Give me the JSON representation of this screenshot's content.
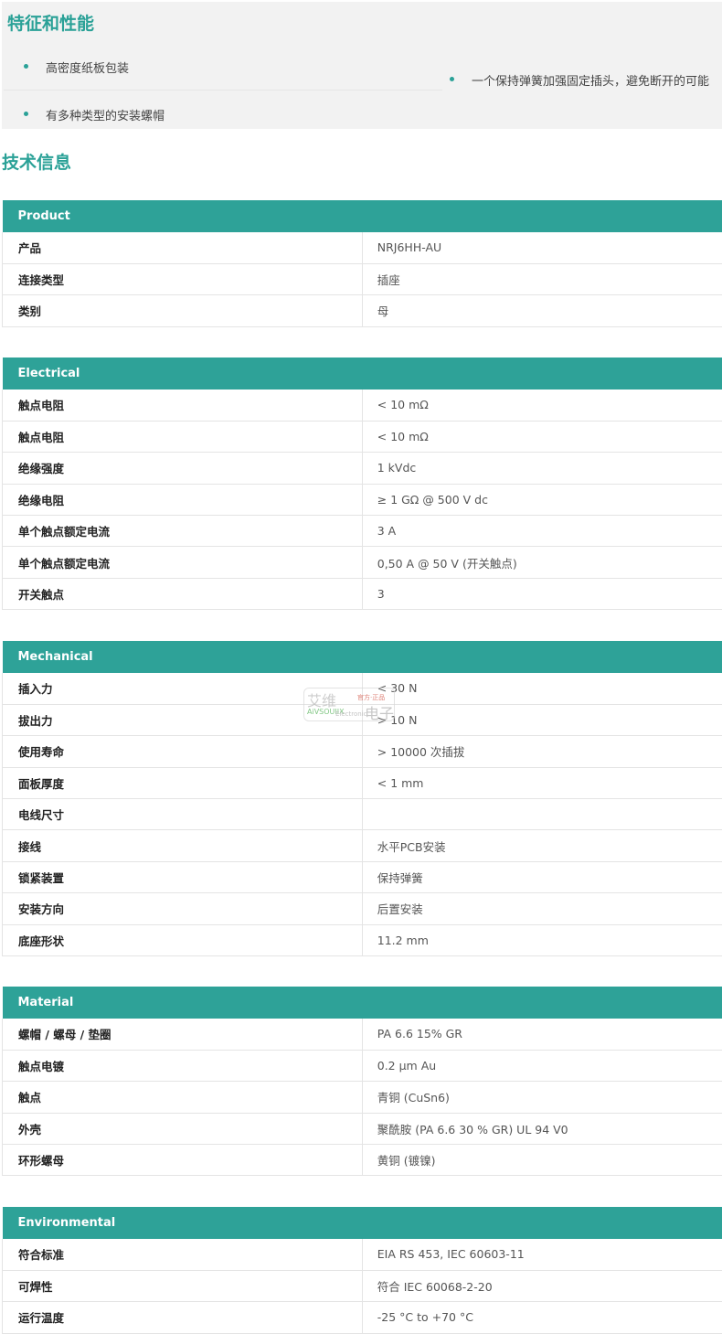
{
  "features": {
    "title": "特征和性能",
    "items": [
      "高密度纸板包装",
      "一个保持弹簧加强固定插头，避免断开的可能",
      "有多种类型的安装螺帽"
    ]
  },
  "tech": {
    "title": "技术信息"
  },
  "watermark": {
    "line1": "艾维",
    "brand": "AiVSOUIIX",
    "electronic": "Electronic",
    "tag": "官方·正品",
    "line2": "电子"
  },
  "sections": {
    "product": {
      "header": "Product",
      "rows": [
        {
          "k": "产品",
          "v": "NRJ6HH-AU"
        },
        {
          "k": "连接类型",
          "v": "插座"
        },
        {
          "k": "类别",
          "v": "母"
        }
      ]
    },
    "electrical": {
      "header": "Electrical",
      "rows": [
        {
          "k": "触点电阻",
          "v": "< 10 mΩ"
        },
        {
          "k": "触点电阻",
          "v": "< 10 mΩ"
        },
        {
          "k": "绝缘强度",
          "v": "1 kVdc"
        },
        {
          "k": "绝缘电阻",
          "v": "≥ 1 GΩ @ 500 V dc"
        },
        {
          "k": "单个触点额定电流",
          "v": "3 A"
        },
        {
          "k": "单个触点额定电流",
          "v": "0,50 A @ 50 V (开关触点)"
        },
        {
          "k": "开关触点",
          "v": "3"
        }
      ]
    },
    "mechanical": {
      "header": "Mechanical",
      "rows": [
        {
          "k": "插入力",
          "v": "< 30 N"
        },
        {
          "k": "拔出力",
          "v": "> 10 N"
        },
        {
          "k": "使用寿命",
          "v": "> 10000 次插拔"
        },
        {
          "k": "面板厚度",
          "v": "< 1 mm"
        },
        {
          "k": "电线尺寸",
          "v": ""
        },
        {
          "k": "接线",
          "v": "水平PCB安装"
        },
        {
          "k": "锁紧装置",
          "v": "保持弹簧"
        },
        {
          "k": "安装方向",
          "v": "后置安装"
        },
        {
          "k": "底座形状",
          "v": "11.2 mm"
        }
      ]
    },
    "material": {
      "header": "Material",
      "rows": [
        {
          "k": "螺帽 / 螺母 / 垫圈",
          "v": "PA 6.6 15% GR"
        },
        {
          "k": "触点电镀",
          "v": "0.2 µm Au"
        },
        {
          "k": "触点",
          "v": "青铜 (CuSn6)"
        },
        {
          "k": "外壳",
          "v": "聚酰胺 (PA 6.6 30 % GR) UL 94 V0"
        },
        {
          "k": "环形螺母",
          "v": "黄铜 (镀镍)"
        }
      ]
    },
    "environmental": {
      "header": "Environmental",
      "rows": [
        {
          "k": "符合标准",
          "v": "EIA RS 453, IEC 60603-11"
        },
        {
          "k": "可焊性",
          "v": "符合 IEC 60068-2-20"
        },
        {
          "k": "运行温度",
          "v": "-25 °C to +70 °C"
        }
      ]
    }
  }
}
